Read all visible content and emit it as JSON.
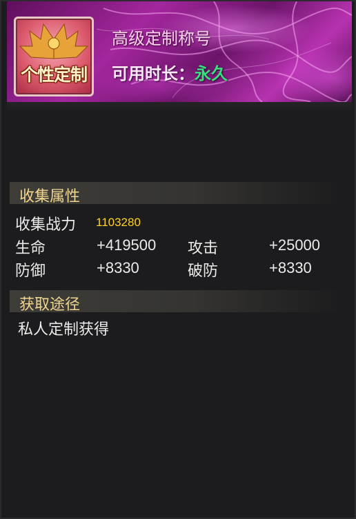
{
  "header": {
    "badge_text": "个性定制",
    "title_name": "高级定制称号",
    "duration_label": "可用时长：",
    "duration_value": "永久"
  },
  "collection": {
    "section_title": "收集属性",
    "power_label": "收集战力",
    "power_value": "1103280",
    "stats": [
      {
        "label": "生命",
        "value": "+419500"
      },
      {
        "label": "攻击",
        "value": "+25000"
      },
      {
        "label": "防御",
        "value": "+8330"
      },
      {
        "label": "破防",
        "value": "+8330"
      }
    ]
  },
  "source": {
    "section_title": "获取途径",
    "text": "私人定制获得"
  },
  "colors": {
    "header_magenta": "#a3269d",
    "section_title_gold": "#f0d58e",
    "power_yellow": "#ffd21f",
    "duration_green": "#36e07a"
  }
}
